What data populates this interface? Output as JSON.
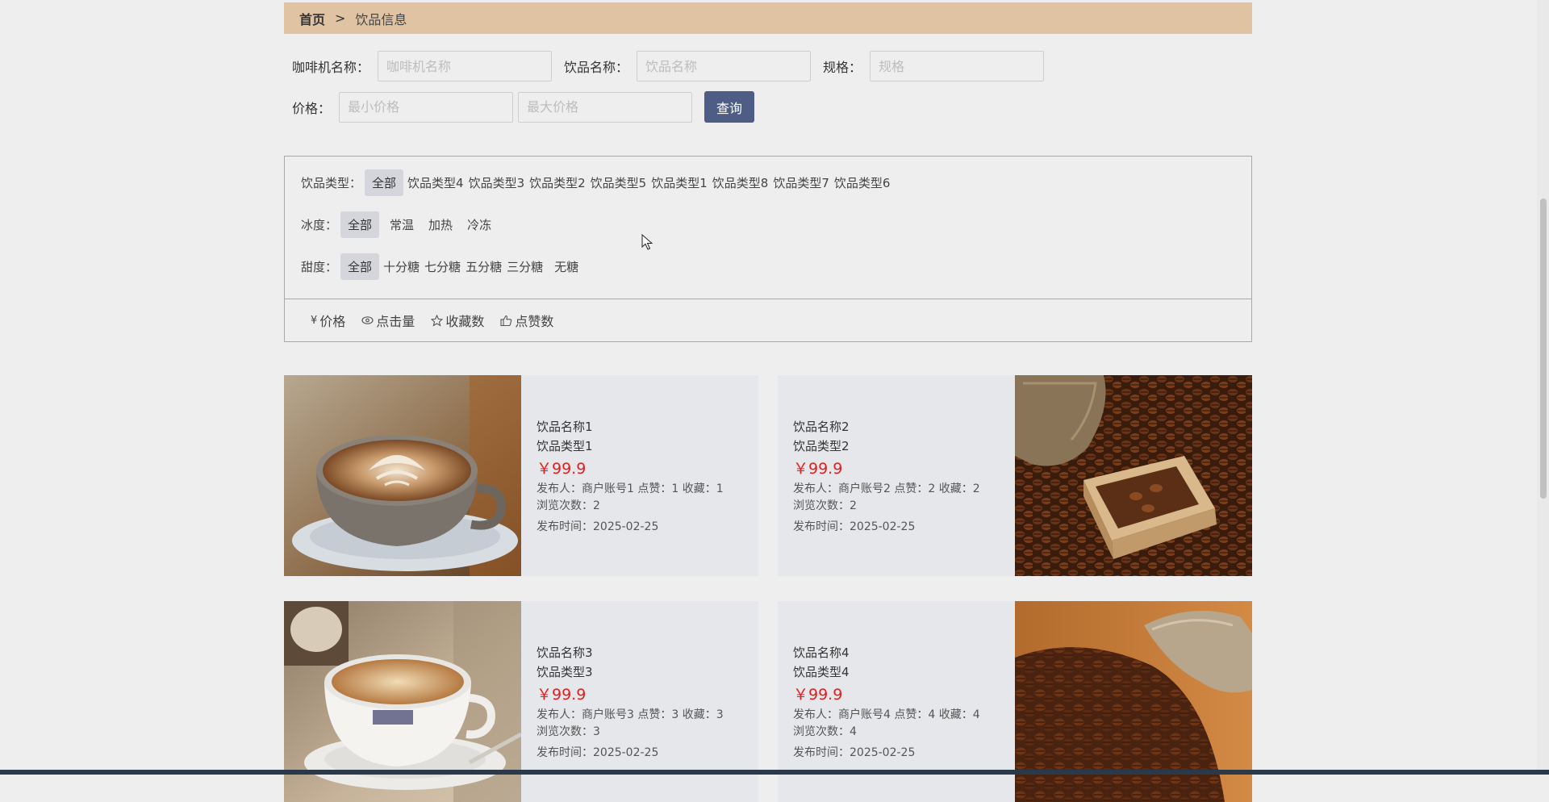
{
  "breadcrumb": {
    "home": "首页",
    "separator": ">",
    "current": "饮品信息"
  },
  "search": {
    "machine_label": "咖啡机名称：",
    "machine_placeholder": "咖啡机名称",
    "drink_label": "饮品名称：",
    "drink_placeholder": "饮品名称",
    "spec_label": "规格：",
    "spec_placeholder": "规格",
    "price_label": "价格：",
    "min_placeholder": "最小价格",
    "max_placeholder": "最大价格",
    "button": "查询"
  },
  "filters": {
    "type_label": "饮品类型：",
    "types": [
      "全部",
      "饮品类型4",
      "饮品类型3",
      "饮品类型2",
      "饮品类型5",
      "饮品类型1",
      "饮品类型8",
      "饮品类型7",
      "饮品类型6"
    ],
    "ice_label": "冰度：",
    "ice": [
      "全部",
      "常温",
      "加热",
      "冷冻"
    ],
    "sweet_label": "甜度：",
    "sweet": [
      "全部",
      "十分糖",
      "七分糖",
      "五分糖",
      "三分糖",
      "无糖"
    ]
  },
  "sort": {
    "price": "价格",
    "clicks": "点击量",
    "favorites": "收藏数",
    "likes": "点赞数",
    "yen_symbol": "¥"
  },
  "products": [
    {
      "name": "饮品名称1",
      "type": "饮品类型1",
      "price": "￥99.9",
      "meta": "发布人：商户账号1  点赞：1  收藏：1",
      "views": "浏览次数：2",
      "time": "发布时间：2025-02-25"
    },
    {
      "name": "饮品名称2",
      "type": "饮品类型2",
      "price": "￥99.9",
      "meta": "发布人：商户账号2  点赞：2  收藏：2",
      "views": "浏览次数：2",
      "time": "发布时间：2025-02-25"
    },
    {
      "name": "饮品名称3",
      "type": "饮品类型3",
      "price": "￥99.9",
      "meta": "发布人：商户账号3  点赞：3  收藏：3",
      "views": "浏览次数：3",
      "time": "发布时间：2025-02-25"
    },
    {
      "name": "饮品名称4",
      "type": "饮品类型4",
      "price": "￥99.9",
      "meta": "发布人：商户账号4  点赞：4  收藏：4",
      "views": "浏览次数：4",
      "time": "发布时间：2025-02-25"
    }
  ],
  "colors": {
    "breadcrumb_bg": "#dfc3a3",
    "button_bg": "#4e5d86",
    "price": "#e02020",
    "active_chip": "#d4d6dc"
  }
}
